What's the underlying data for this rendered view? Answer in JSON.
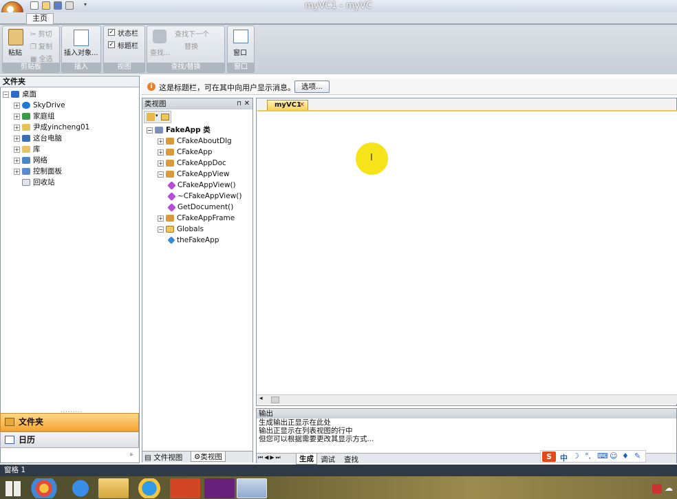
{
  "window": {
    "title": "myVC1 - myVC"
  },
  "ribbon": {
    "tab_main": "主页",
    "clipboard": {
      "paste": "粘贴",
      "cut": "剪切",
      "copy": "复制",
      "select_all": "全选",
      "label": "剪贴板"
    },
    "insert": {
      "insert_object": "插入对象...",
      "label": "插入"
    },
    "view": {
      "status_bar": "状态栏",
      "title_bar": "标题栏",
      "label": "视图"
    },
    "find": {
      "find": "查找...",
      "find_next": "查找下一个",
      "replace": "替换",
      "label": "查找/替换"
    },
    "window": {
      "window_btn": "窗口",
      "label": "窗口"
    }
  },
  "folder_pane": {
    "title": "文件夹",
    "items": [
      {
        "label": "桌面",
        "level": 0
      },
      {
        "label": "SkyDrive",
        "level": 1
      },
      {
        "label": "家庭组",
        "level": 1
      },
      {
        "label": "尹成yincheng01",
        "level": 1
      },
      {
        "label": "这台电脑",
        "level": 1
      },
      {
        "label": "库",
        "level": 1
      },
      {
        "label": "网络",
        "level": 1
      },
      {
        "label": "控制面板",
        "level": 1
      },
      {
        "label": "回收站",
        "level": 1
      }
    ],
    "nav_folders": "文件夹",
    "nav_calendar": "日历"
  },
  "infobar": {
    "message": "这是标题栏，可在其中向用户显示消息。",
    "options_btn": "选项..."
  },
  "class_view": {
    "title": "类视图",
    "root": "FakeApp 类",
    "items": [
      "CFakeAboutDlg",
      "CFakeApp",
      "CFakeAppDoc",
      "CFakeAppView",
      "CFakeAppView()",
      "~CFakeAppView()",
      "GetDocument()",
      "CFakeAppFrame",
      "Globals",
      "theFakeApp"
    ],
    "tab_file_view": "文件视图",
    "tab_class_view": "类视图"
  },
  "document": {
    "tab": "myVC1"
  },
  "output": {
    "title": "输出",
    "lines": [
      "生成输出正显示在此处",
      "输出正显示在列表视图的行中",
      "但您可以根据需要更改其显示方式..."
    ],
    "tabs": [
      "生成",
      "调试",
      "查找"
    ]
  },
  "statusbar": {
    "text": "窗格 1"
  },
  "ime": {
    "lang": "中"
  }
}
